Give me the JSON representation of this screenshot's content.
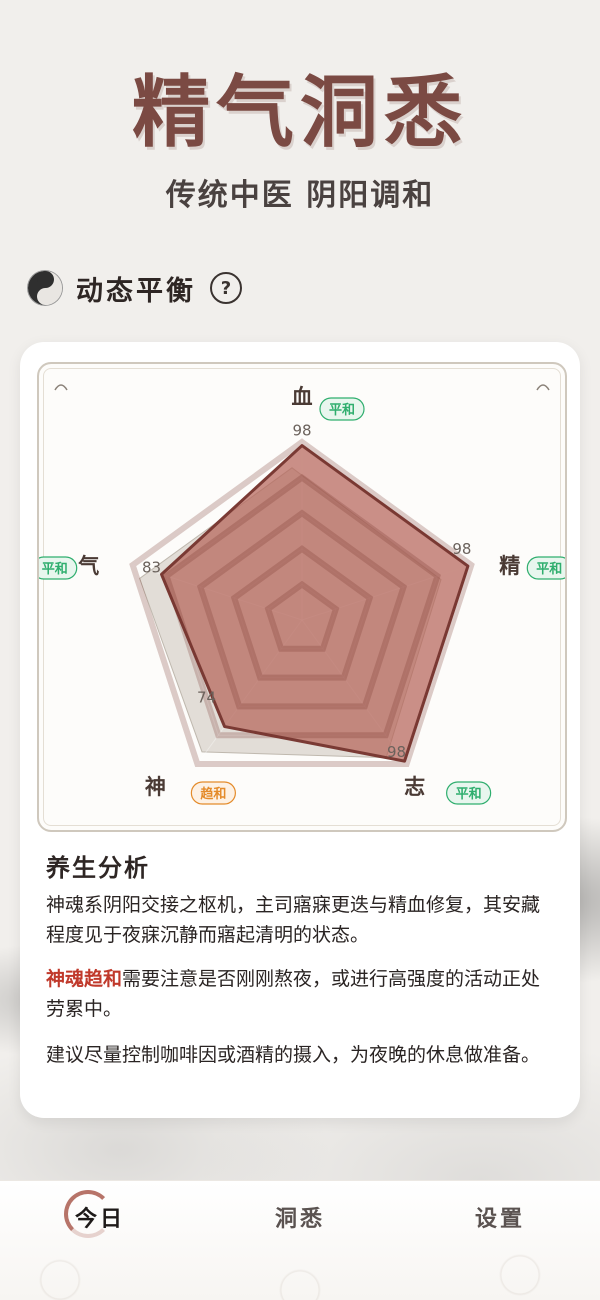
{
  "app_title": "精气洞悉",
  "subtitle": "传统中医 阴阳调和",
  "section": {
    "title": "动态平衡",
    "help_icon": "question-circle-icon"
  },
  "colors": {
    "accent": "#7b4a43",
    "radar_fill": "#b5655a",
    "radar_stroke": "#7a3a34",
    "baseline_fill": "#d8d3cb",
    "status_calm": "#2fae6e",
    "status_trend": "#e48b2a",
    "highlight_red": "#c0392b"
  },
  "chart_data": {
    "type": "radar",
    "axes": [
      {
        "name": "血",
        "value": 98,
        "status": "平和"
      },
      {
        "name": "精",
        "value": 98,
        "status": "平和"
      },
      {
        "name": "志",
        "value": 98,
        "status": "平和"
      },
      {
        "name": "神",
        "value": 74,
        "status": "趋和"
      },
      {
        "name": "气",
        "value": 83,
        "status": "平和"
      }
    ],
    "range": [
      0,
      100
    ],
    "rings": 5
  },
  "analysis": {
    "title": "养生分析",
    "p1": "神魂系阴阳交接之枢机，主司寤寐更迭与精血修复，其安藏程度见于夜寐沉静而寤起清明的状态。",
    "p2_highlight": "神魂趋和",
    "p2_rest": "需要注意是否刚刚熬夜，或进行高强度的活动正处劳累中。",
    "p3": "建议尽量控制咖啡因或酒精的摄入，为夜晚的休息做准备。"
  },
  "tabs": {
    "today": "今日",
    "insight": "洞悉",
    "settings": "设置"
  }
}
